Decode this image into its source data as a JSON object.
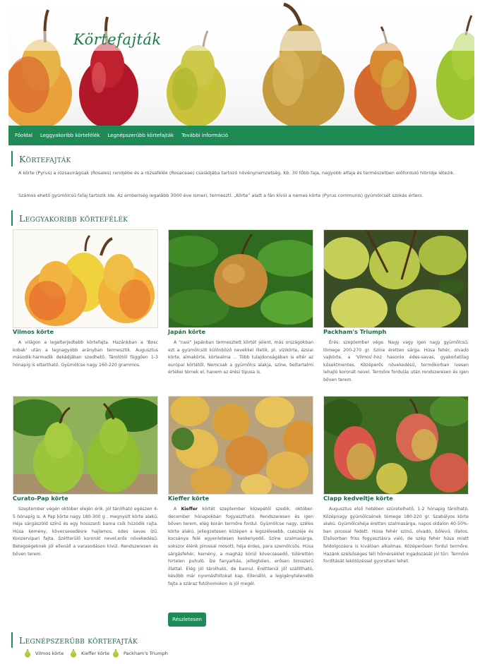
{
  "site": {
    "title": "Körtefajták"
  },
  "nav": {
    "items": [
      "Főoldal",
      "Leggyakoribb körtefélék",
      "Legnépszerűbb körtefajták",
      "További információ"
    ]
  },
  "intro": {
    "heading": "Körtefajták",
    "p1": "A körte (Pyrus) a rózsavirágúak (Rosales) rendjébe és a rózsafélék (Rosaceae) családjába tartozó növénynemzetség. Kb. 30 főbb faja, nagyobb alfaja és természetben előforduló hibridje létezik.",
    "p2": "Számos ehető gyümölcsű fafaj tartozik ide. Az emberiség legalább 3000 éve ismeri, termeszti. „Körte” alatt a fán kívül a nemes körte (Pyrus communis) gyümölcsét szokás érteni."
  },
  "common": {
    "heading": "Leggyakoribb körtefélék",
    "cards": [
      {
        "name": "Vilmos körte",
        "text": "A világon a legelterjedtebb körtefajta. Hazánkban a 'Bosc kobak' után a legnagyobb arányban termesztik. Augusztus második-harmadik dekádjában szedhető. Tárolótól függően 1-3 hónapig is eltartható. Gyümölcse nagy 160-220 grammos."
      },
      {
        "name": "Japán körte",
        "text": "A \"nasi\" Japánban termesztett körtét jelent, más országokban ezt a gyümölcsöt különböző nevekkel illetik, pl. vízikörte, ázsiai körte, almakörte, körtealma ... Több tulajdonságában is eltér az európai körtétől. Nemcsak a gyümölcs alakja, színe, beltartalmi értékei térnek el, hanem az érési típusa is."
      },
      {
        "name": "Packham's Triumph",
        "text": "Érés: szeptember vége. Nagy vagy igen nagy gyümölcsű, tömege 200-270 gr. Színe éretten sárga. Húsa fehér, olvadó vajkörte, a 'Vilmos'-hoz hasonlo édes-savas, gyakorlatilag kősektmentes. Középerős növekedésű, termőkorban ívesen lehajló koronát nevel. Termőre fordulás után rendszeresen és igen bőven terem."
      },
      {
        "name": "Curato-Pap körte",
        "text": "Szeptember végén október elején érik. Jól tárolható egészen 4-5 hónapig is. A Pap körte nagy 180-300 g , megnyúlt körte alakú. Héja sárgászöld színű és egy hosszanti barna csík húzódik rajta. Húsa kemény, kövecsesedésre hajlamos, édes savas ízű. Konzervipari fajta. Szétterülő koronát nevel,erős növekedésű. Betegségeknek jól ellenáll a varasodáson kívül. Rendszeresen és bőven terem."
      },
      {
        "name": "Kieffer körte",
        "bold": "Kieffer",
        "text_pre": "A ",
        "text_post": " körtét szeptember közepétől szedik, október-december hónapokban fogyasztható. Rendszeresen és igen bőven terem, elég korán termőre fordul. Gyümölcse nagy, széles körte alakú, jellegzetesen középen a legszélesebb, csészéje és kocsánya felé egyenletesen keskenyedő. Színe szalmasárga, sokszor élénk pirossal mosott, héja érdes, para szemölcsös. Húsa sárgásfehér, kemény, a magház körül kövecsesedő, túlérettén hirtelen puhuló. Íze fanyarkás, jellegtelen, erősen birsszerű illattal. Elég jól tárolható, de barnul. Érettlenül jól szállítható, később már nyomásfoltokat kap. Ellenálló, a legigénytelenebb fajta a száraz futóhomokon is jól megél."
      },
      {
        "name": "Clapp kedveltje körte",
        "text": "Augusztus első hetében szüretelhető, 1-2 hónapig tárolható. Középnagy gyümölcsének tömege 180-220 gr. Szabályos körte alakú. Gyümölcshéja éretten szalmasárga, napos oldalon 40-50%-ban pirossal fedett. Húsa fehér színű, olvadó, bőlevű, illatos. Elsősorban friss fogyasztásra való, de szép fehér húsa miatt feldolgozásra is kiválóan alkalmas. Középerősen fordul termőre. Hazánk szélsőséges téli hőmérséklet ingadozását jól tűri. Termőre fordítását lekötözéssel gyorsítani lehet."
      }
    ],
    "more_button": "Részletesen"
  },
  "popular": {
    "heading": "Legnépszerűbb körtefajták",
    "items": [
      "Vilmos körte",
      "Kieffer körte",
      "Packham's Triumph"
    ]
  },
  "colors": {
    "accent": "#1f8a56",
    "heading": "#1e6b45"
  },
  "icons": {
    "pear": "pear-icon"
  }
}
